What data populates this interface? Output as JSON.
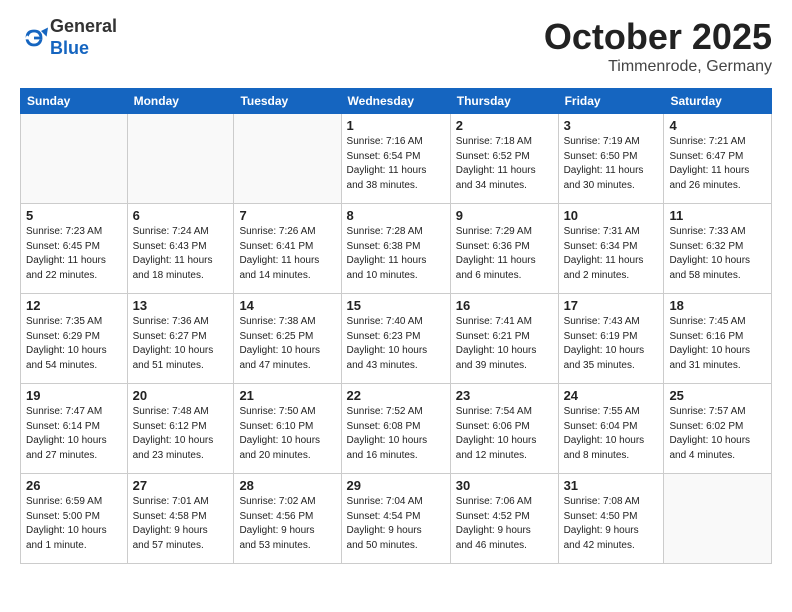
{
  "header": {
    "logo_general": "General",
    "logo_blue": "Blue",
    "month": "October 2025",
    "location": "Timmenrode, Germany"
  },
  "weekdays": [
    "Sunday",
    "Monday",
    "Tuesday",
    "Wednesday",
    "Thursday",
    "Friday",
    "Saturday"
  ],
  "weeks": [
    [
      {
        "day": "",
        "info": ""
      },
      {
        "day": "",
        "info": ""
      },
      {
        "day": "",
        "info": ""
      },
      {
        "day": "1",
        "info": "Sunrise: 7:16 AM\nSunset: 6:54 PM\nDaylight: 11 hours\nand 38 minutes."
      },
      {
        "day": "2",
        "info": "Sunrise: 7:18 AM\nSunset: 6:52 PM\nDaylight: 11 hours\nand 34 minutes."
      },
      {
        "day": "3",
        "info": "Sunrise: 7:19 AM\nSunset: 6:50 PM\nDaylight: 11 hours\nand 30 minutes."
      },
      {
        "day": "4",
        "info": "Sunrise: 7:21 AM\nSunset: 6:47 PM\nDaylight: 11 hours\nand 26 minutes."
      }
    ],
    [
      {
        "day": "5",
        "info": "Sunrise: 7:23 AM\nSunset: 6:45 PM\nDaylight: 11 hours\nand 22 minutes."
      },
      {
        "day": "6",
        "info": "Sunrise: 7:24 AM\nSunset: 6:43 PM\nDaylight: 11 hours\nand 18 minutes."
      },
      {
        "day": "7",
        "info": "Sunrise: 7:26 AM\nSunset: 6:41 PM\nDaylight: 11 hours\nand 14 minutes."
      },
      {
        "day": "8",
        "info": "Sunrise: 7:28 AM\nSunset: 6:38 PM\nDaylight: 11 hours\nand 10 minutes."
      },
      {
        "day": "9",
        "info": "Sunrise: 7:29 AM\nSunset: 6:36 PM\nDaylight: 11 hours\nand 6 minutes."
      },
      {
        "day": "10",
        "info": "Sunrise: 7:31 AM\nSunset: 6:34 PM\nDaylight: 11 hours\nand 2 minutes."
      },
      {
        "day": "11",
        "info": "Sunrise: 7:33 AM\nSunset: 6:32 PM\nDaylight: 10 hours\nand 58 minutes."
      }
    ],
    [
      {
        "day": "12",
        "info": "Sunrise: 7:35 AM\nSunset: 6:29 PM\nDaylight: 10 hours\nand 54 minutes."
      },
      {
        "day": "13",
        "info": "Sunrise: 7:36 AM\nSunset: 6:27 PM\nDaylight: 10 hours\nand 51 minutes."
      },
      {
        "day": "14",
        "info": "Sunrise: 7:38 AM\nSunset: 6:25 PM\nDaylight: 10 hours\nand 47 minutes."
      },
      {
        "day": "15",
        "info": "Sunrise: 7:40 AM\nSunset: 6:23 PM\nDaylight: 10 hours\nand 43 minutes."
      },
      {
        "day": "16",
        "info": "Sunrise: 7:41 AM\nSunset: 6:21 PM\nDaylight: 10 hours\nand 39 minutes."
      },
      {
        "day": "17",
        "info": "Sunrise: 7:43 AM\nSunset: 6:19 PM\nDaylight: 10 hours\nand 35 minutes."
      },
      {
        "day": "18",
        "info": "Sunrise: 7:45 AM\nSunset: 6:16 PM\nDaylight: 10 hours\nand 31 minutes."
      }
    ],
    [
      {
        "day": "19",
        "info": "Sunrise: 7:47 AM\nSunset: 6:14 PM\nDaylight: 10 hours\nand 27 minutes."
      },
      {
        "day": "20",
        "info": "Sunrise: 7:48 AM\nSunset: 6:12 PM\nDaylight: 10 hours\nand 23 minutes."
      },
      {
        "day": "21",
        "info": "Sunrise: 7:50 AM\nSunset: 6:10 PM\nDaylight: 10 hours\nand 20 minutes."
      },
      {
        "day": "22",
        "info": "Sunrise: 7:52 AM\nSunset: 6:08 PM\nDaylight: 10 hours\nand 16 minutes."
      },
      {
        "day": "23",
        "info": "Sunrise: 7:54 AM\nSunset: 6:06 PM\nDaylight: 10 hours\nand 12 minutes."
      },
      {
        "day": "24",
        "info": "Sunrise: 7:55 AM\nSunset: 6:04 PM\nDaylight: 10 hours\nand 8 minutes."
      },
      {
        "day": "25",
        "info": "Sunrise: 7:57 AM\nSunset: 6:02 PM\nDaylight: 10 hours\nand 4 minutes."
      }
    ],
    [
      {
        "day": "26",
        "info": "Sunrise: 6:59 AM\nSunset: 5:00 PM\nDaylight: 10 hours\nand 1 minute."
      },
      {
        "day": "27",
        "info": "Sunrise: 7:01 AM\nSunset: 4:58 PM\nDaylight: 9 hours\nand 57 minutes."
      },
      {
        "day": "28",
        "info": "Sunrise: 7:02 AM\nSunset: 4:56 PM\nDaylight: 9 hours\nand 53 minutes."
      },
      {
        "day": "29",
        "info": "Sunrise: 7:04 AM\nSunset: 4:54 PM\nDaylight: 9 hours\nand 50 minutes."
      },
      {
        "day": "30",
        "info": "Sunrise: 7:06 AM\nSunset: 4:52 PM\nDaylight: 9 hours\nand 46 minutes."
      },
      {
        "day": "31",
        "info": "Sunrise: 7:08 AM\nSunset: 4:50 PM\nDaylight: 9 hours\nand 42 minutes."
      },
      {
        "day": "",
        "info": ""
      }
    ]
  ]
}
